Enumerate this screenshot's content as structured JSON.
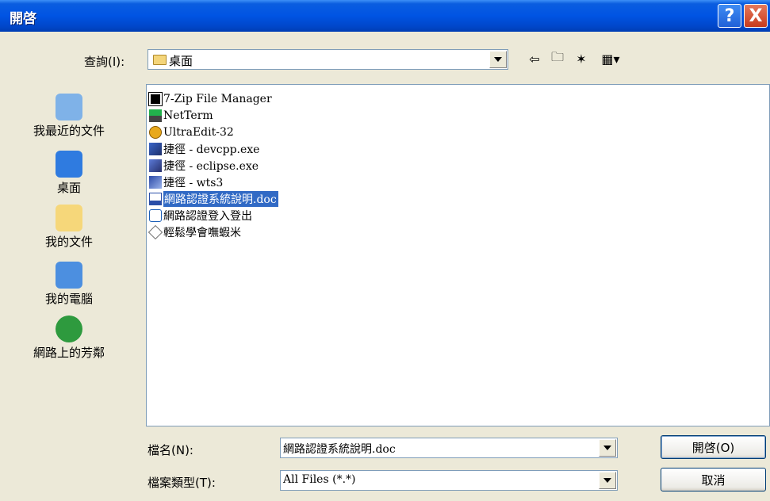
{
  "window": {
    "title": "開啓"
  },
  "titlebar": {
    "help_glyph": "?",
    "close_glyph": "X"
  },
  "lookin": {
    "label": "查詢(I):",
    "value": "桌面"
  },
  "toolbar": [
    {
      "name": "back-icon",
      "glyph": "⇦"
    },
    {
      "name": "up-folder-icon",
      "glyph": "🗀"
    },
    {
      "name": "new-folder-icon",
      "glyph": "✶"
    },
    {
      "name": "view-menu-icon",
      "glyph": "▦▾"
    }
  ],
  "places": [
    {
      "label": "我最近的文件",
      "icon": "recent-documents-icon",
      "color": "#7fb2e8"
    },
    {
      "label": "桌面",
      "icon": "desktop-icon",
      "color": "#2f7be0"
    },
    {
      "label": "我的文件",
      "icon": "my-documents-icon",
      "color": "#f6d77a"
    },
    {
      "label": "我的電腦",
      "icon": "my-computer-icon",
      "color": "#4c8fe0"
    },
    {
      "label": "網路上的芳鄰",
      "icon": "network-places-icon",
      "color": "#2e9a3e"
    }
  ],
  "files": [
    {
      "label": "7-Zip File Manager",
      "icon": "7zip-icon"
    },
    {
      "label": "NetTerm",
      "icon": "netterm-icon"
    },
    {
      "label": "UltraEdit-32",
      "icon": "ultraedit-icon"
    },
    {
      "label": "捷徑 - devcpp.exe",
      "icon": "devcpp-shortcut-icon"
    },
    {
      "label": "捷徑 - eclipse.exe",
      "icon": "eclipse-shortcut-icon"
    },
    {
      "label": "捷徑 - wts3",
      "icon": "wts3-shortcut-icon"
    },
    {
      "label": "網路認證系統說明.doc",
      "icon": "word-document-icon",
      "selected": true
    },
    {
      "label": "網路認證登入登出",
      "icon": "html-shortcut-icon"
    },
    {
      "label": "輕鬆學會嘸蝦米",
      "icon": "program-shortcut-icon"
    }
  ],
  "filename": {
    "label": "檔名(N):",
    "value": "網路認證系統說明.doc"
  },
  "filetype": {
    "label": "檔案類型(T):",
    "value": "All Files (*.*)"
  },
  "buttons": {
    "open": "開啓(O)",
    "cancel": "取消"
  }
}
